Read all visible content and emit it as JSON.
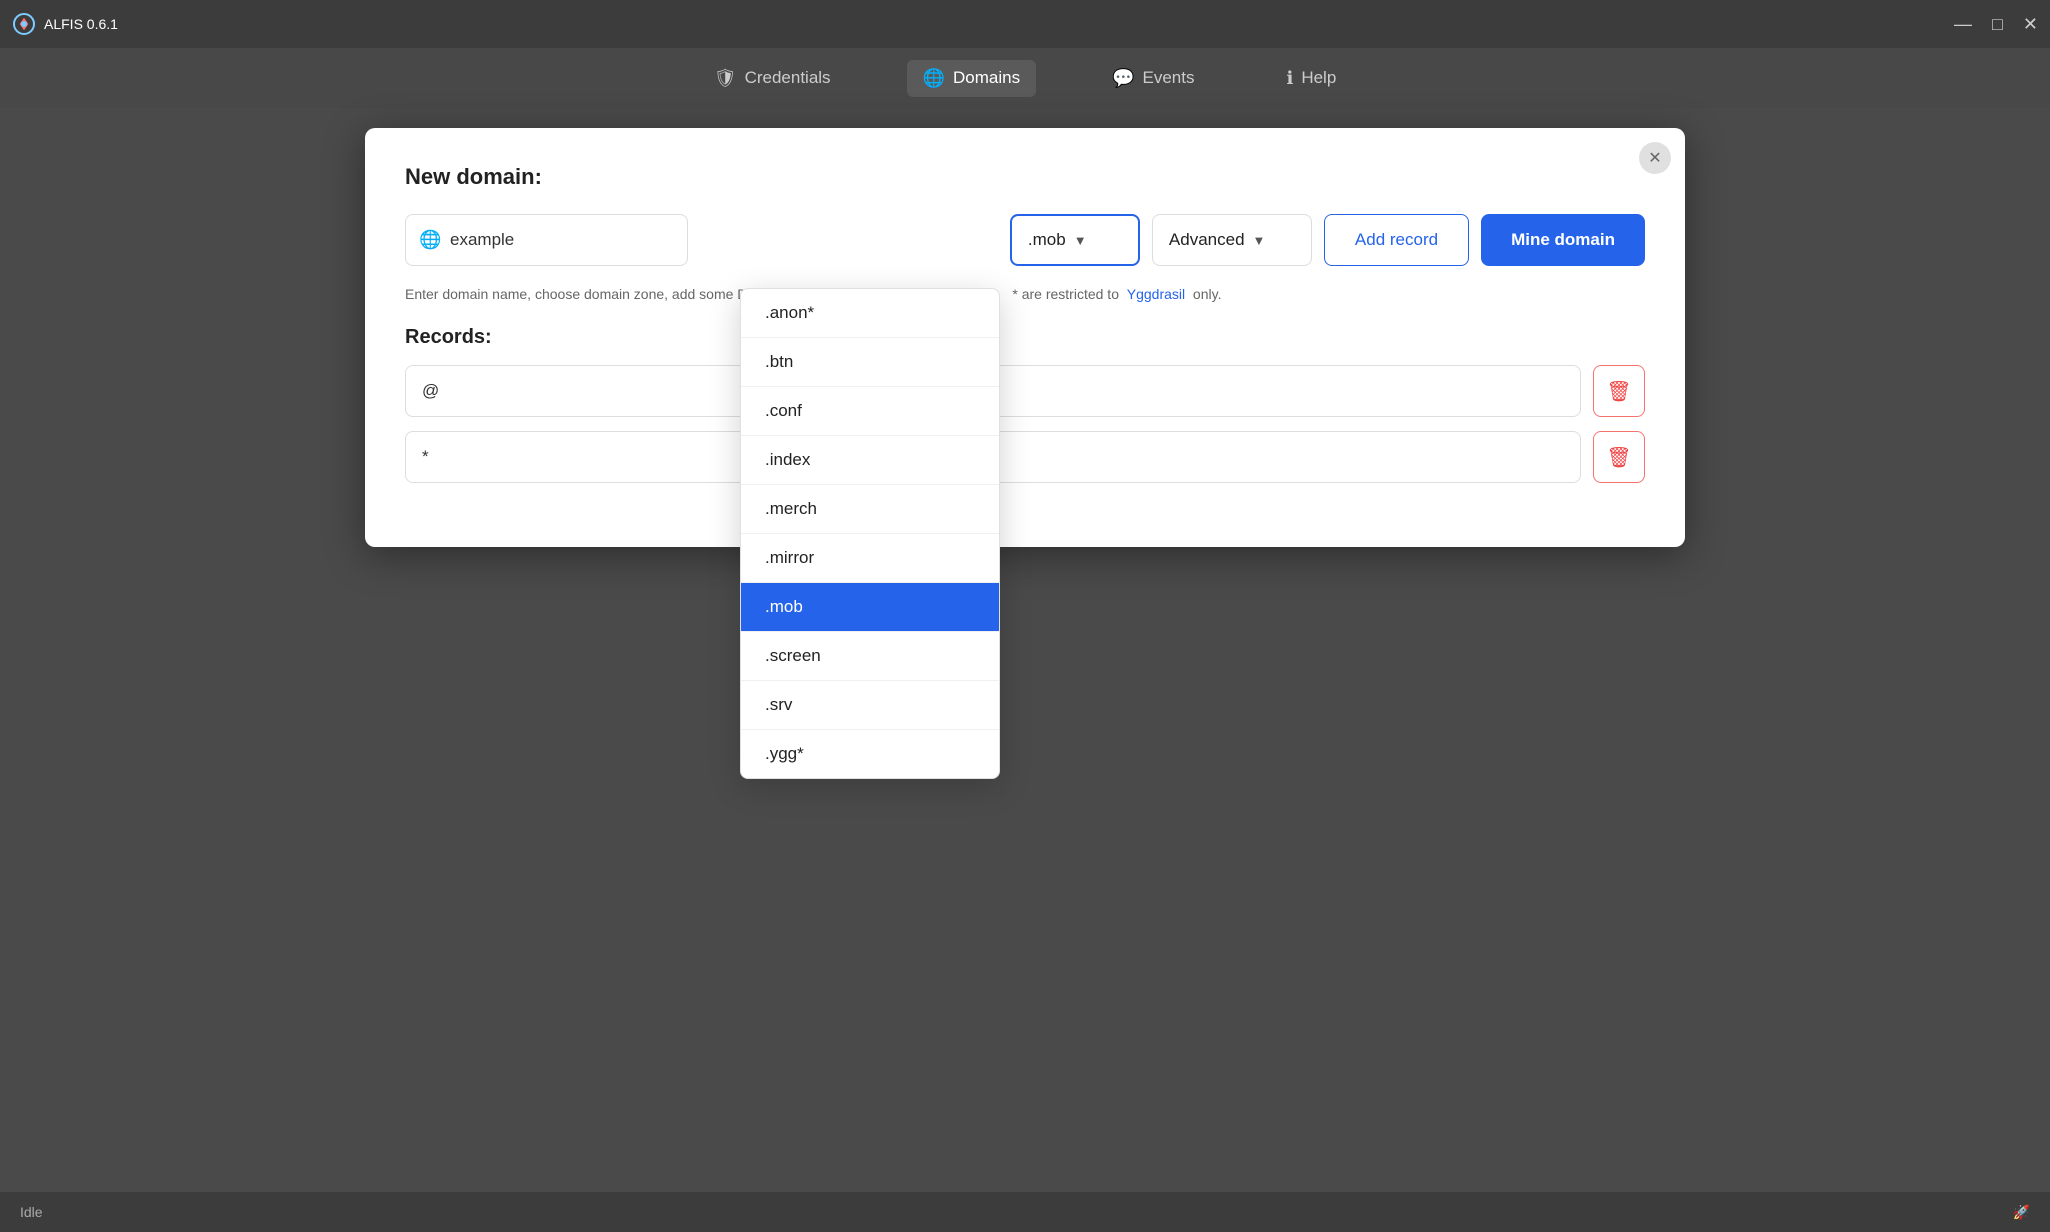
{
  "app": {
    "title": "ALFIS 0.6.1",
    "minimize_label": "—",
    "maximize_label": "□",
    "close_label": "✕"
  },
  "navbar": {
    "items": [
      {
        "id": "credentials",
        "label": "Credentials",
        "icon": "🛡"
      },
      {
        "id": "domains",
        "label": "Domains",
        "icon": "🌐",
        "active": true
      },
      {
        "id": "events",
        "label": "Events",
        "icon": "💬"
      },
      {
        "id": "help",
        "label": "Help",
        "icon": "ℹ"
      }
    ]
  },
  "modal": {
    "title": "New domain:",
    "close_label": "✕",
    "domain_input_placeholder": "example",
    "domain_input_value": "example",
    "selected_zone": ".mob",
    "advanced_label": "Advanced",
    "add_record_label": "Add record",
    "mine_domain_label": "Mine domain",
    "info_text": "Enter domain name, choose domain zone, add some DNS-records, then hit the \"Mine",
    "info_text2": "* are restricted to",
    "info_link": "Yggdrasil",
    "info_text3": "only.",
    "records_label": "Records:",
    "records": [
      {
        "name": "@",
        "type": "A",
        "value": "3"
      },
      {
        "name": "*",
        "type": "A",
        "value": "3"
      }
    ]
  },
  "zone_dropdown": {
    "options": [
      {
        "value": ".anon*",
        "label": ".anon*"
      },
      {
        "value": ".btn",
        "label": ".btn"
      },
      {
        "value": ".conf",
        "label": ".conf"
      },
      {
        "value": ".index",
        "label": ".index"
      },
      {
        "value": ".merch",
        "label": ".merch"
      },
      {
        "value": ".mirror",
        "label": ".mirror"
      },
      {
        "value": ".mob",
        "label": ".mob",
        "selected": true
      },
      {
        "value": ".screen",
        "label": ".screen"
      },
      {
        "value": ".srv",
        "label": ".srv"
      },
      {
        "value": ".ygg*",
        "label": ".ygg*"
      }
    ]
  },
  "statusbar": {
    "status": "Idle",
    "icon": "🚀"
  }
}
